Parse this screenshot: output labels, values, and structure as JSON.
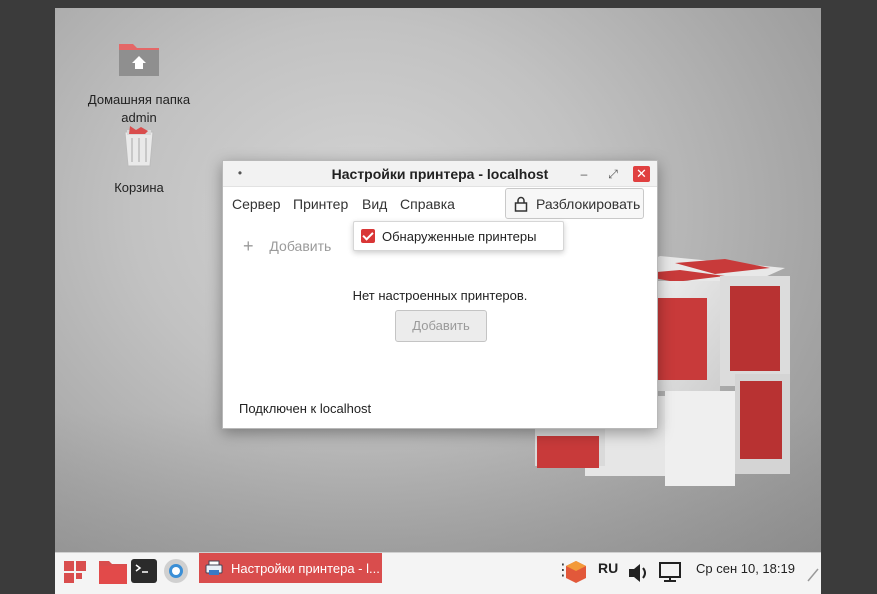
{
  "desktop": {
    "icons": [
      {
        "label_line1": "Домашняя папка",
        "label_line2": "admin",
        "icon": "home-folder-icon"
      },
      {
        "label_line1": "Корзина",
        "icon": "trash-icon"
      }
    ]
  },
  "window": {
    "title": "Настройки принтера - localhost",
    "menu": [
      "Сервер",
      "Принтер",
      "Вид",
      "Справка"
    ],
    "unlock_label": "Разблокировать",
    "toolbar_add": "Добавить",
    "empty_message": "Нет настроенных принтеров.",
    "add_button": "Добавить",
    "status": "Подключен к localhost"
  },
  "dropdown": {
    "item": "Обнаруженные принтеры",
    "checked": true
  },
  "taskbar": {
    "active_task": "Настройки принтера - l...",
    "language": "RU",
    "clock": "Ср сен 10, 18:19"
  },
  "colors": {
    "accent": "#d94d4d",
    "close": "#e04040"
  }
}
